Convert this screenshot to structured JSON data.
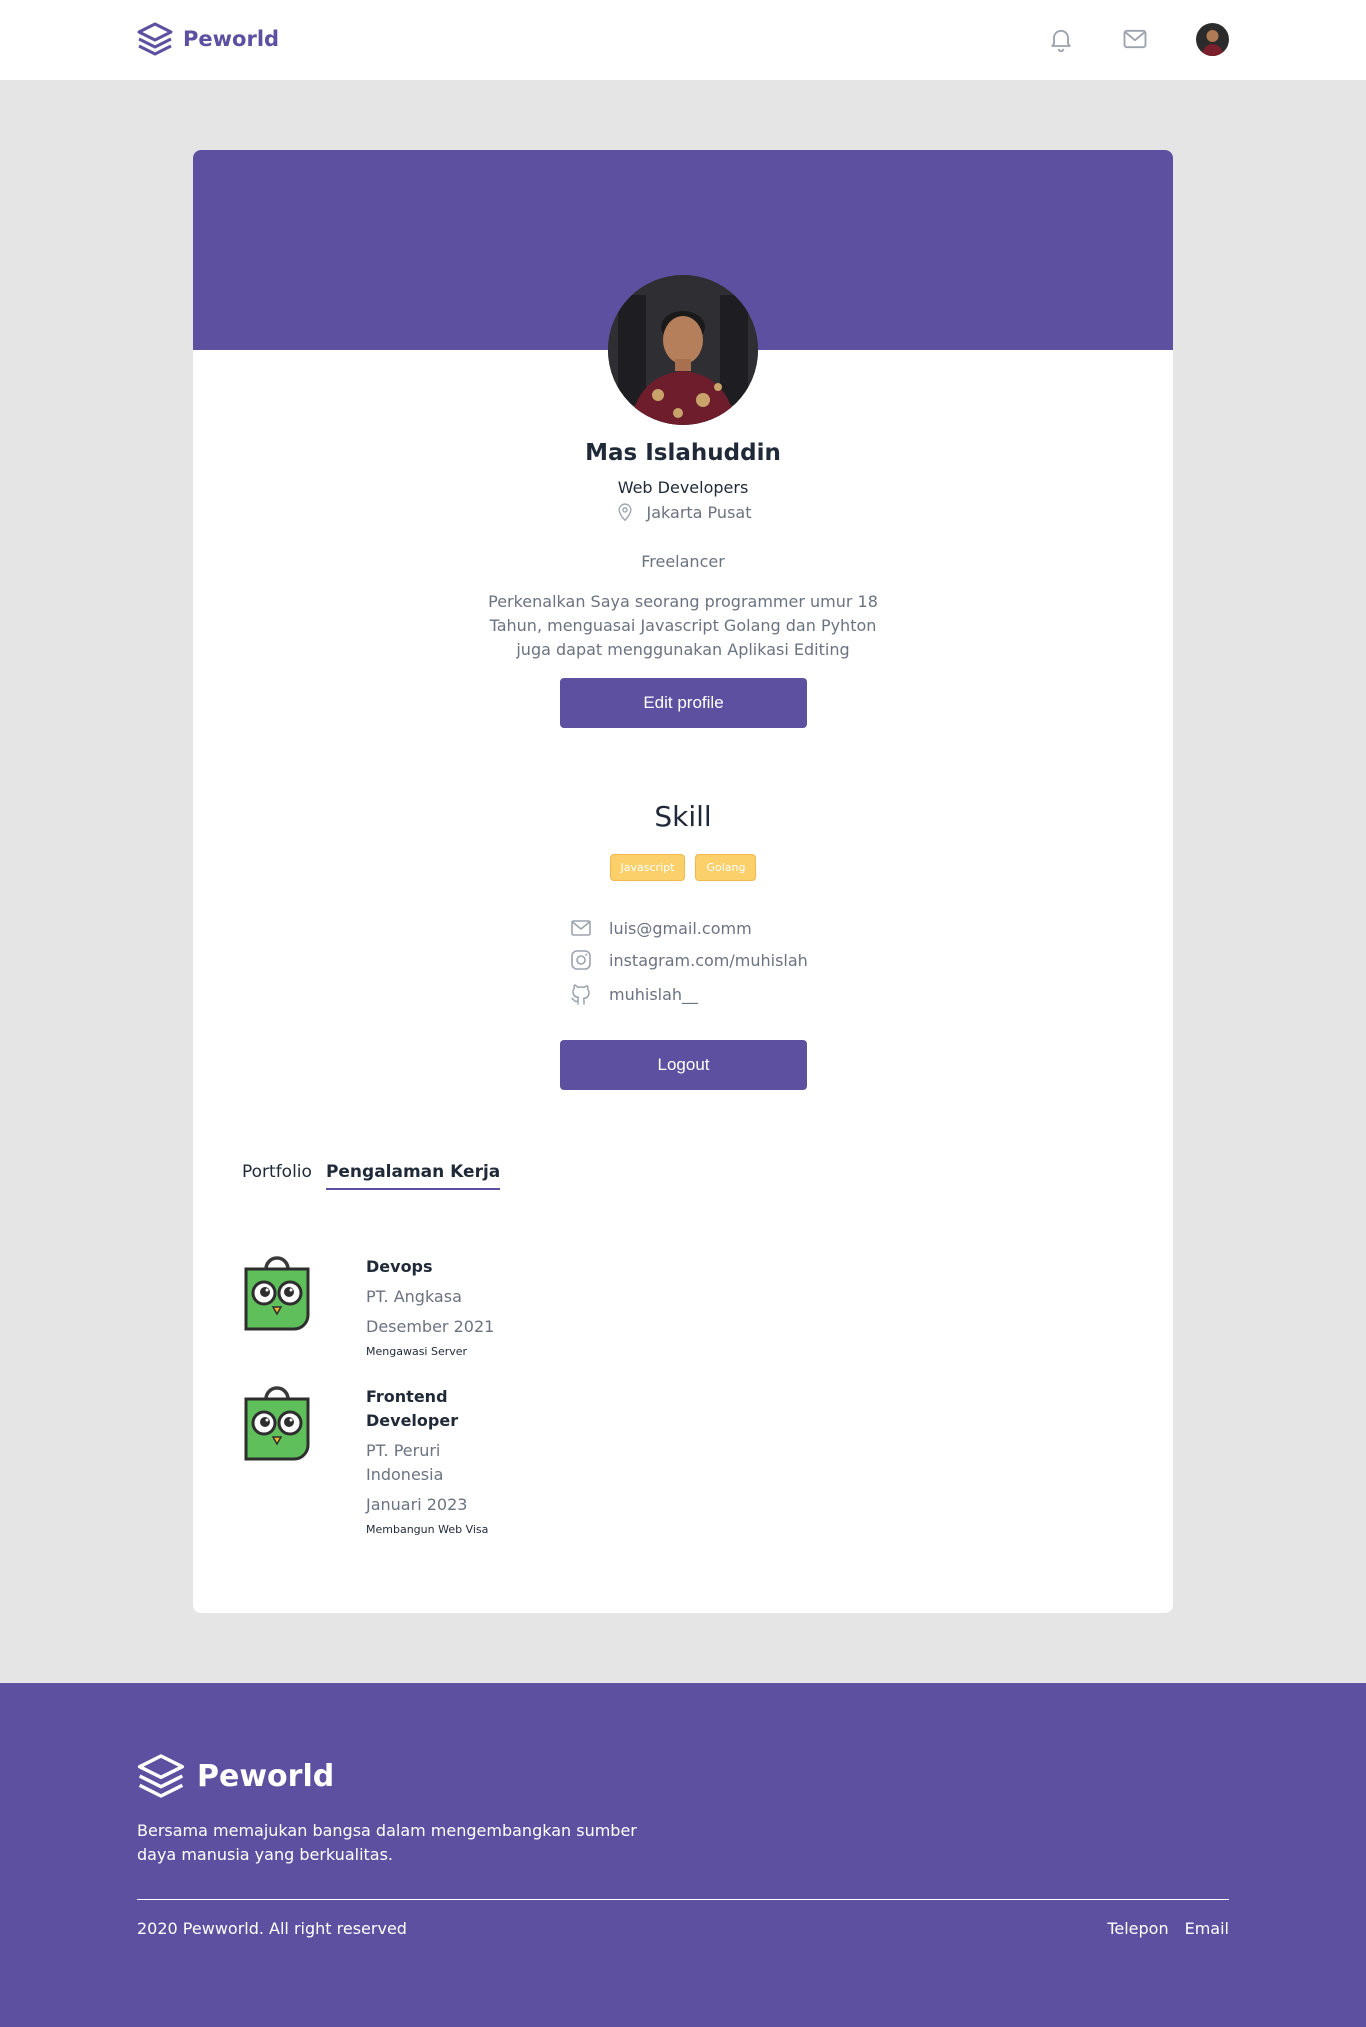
{
  "brand": {
    "name": "Peworld"
  },
  "colors": {
    "primary": "#5e50a1",
    "skill_badge": "#fbcf6a",
    "background": "#e5e5e5"
  },
  "navbar": {
    "icons": [
      "bell-icon",
      "mail-icon"
    ]
  },
  "profile": {
    "name": "Mas Islahuddin",
    "role": "Web Developers",
    "location": "Jakarta Pusat",
    "status": "Freelancer",
    "bio": "Perkenalkan Saya seorang programmer umur 18 Tahun, menguasai Javascript Golang dan Pyhton juga dapat menggunakan Aplikasi Editing",
    "edit_button": "Edit profile"
  },
  "skill": {
    "title": "Skill",
    "items": [
      "Javascript",
      "Golang"
    ]
  },
  "contacts": {
    "email": "luis@gmail.comm",
    "instagram": "instagram.com/muhislah",
    "github": "muhislah__"
  },
  "logout_button": "Logout",
  "tabs": [
    {
      "label": "Portfolio",
      "active": false
    },
    {
      "label": "Pengalaman Kerja",
      "active": true
    }
  ],
  "experiences": [
    {
      "position": "Devops",
      "company": "PT. Angkasa",
      "date": "Desember 2021",
      "description": "Mengawasi Server"
    },
    {
      "position": "Frontend Developer",
      "company": "PT. Peruri Indonesia",
      "date": "Januari 2023",
      "description": "Membangun Web Visa"
    }
  ],
  "footer": {
    "brand": "Peworld",
    "tagline": "Bersama memajukan bangsa dalam mengembangkan sumber daya manusia yang berkualitas.",
    "copyright": "2020 Pewworld. All right reserved",
    "links": [
      "Telepon",
      "Email"
    ]
  }
}
